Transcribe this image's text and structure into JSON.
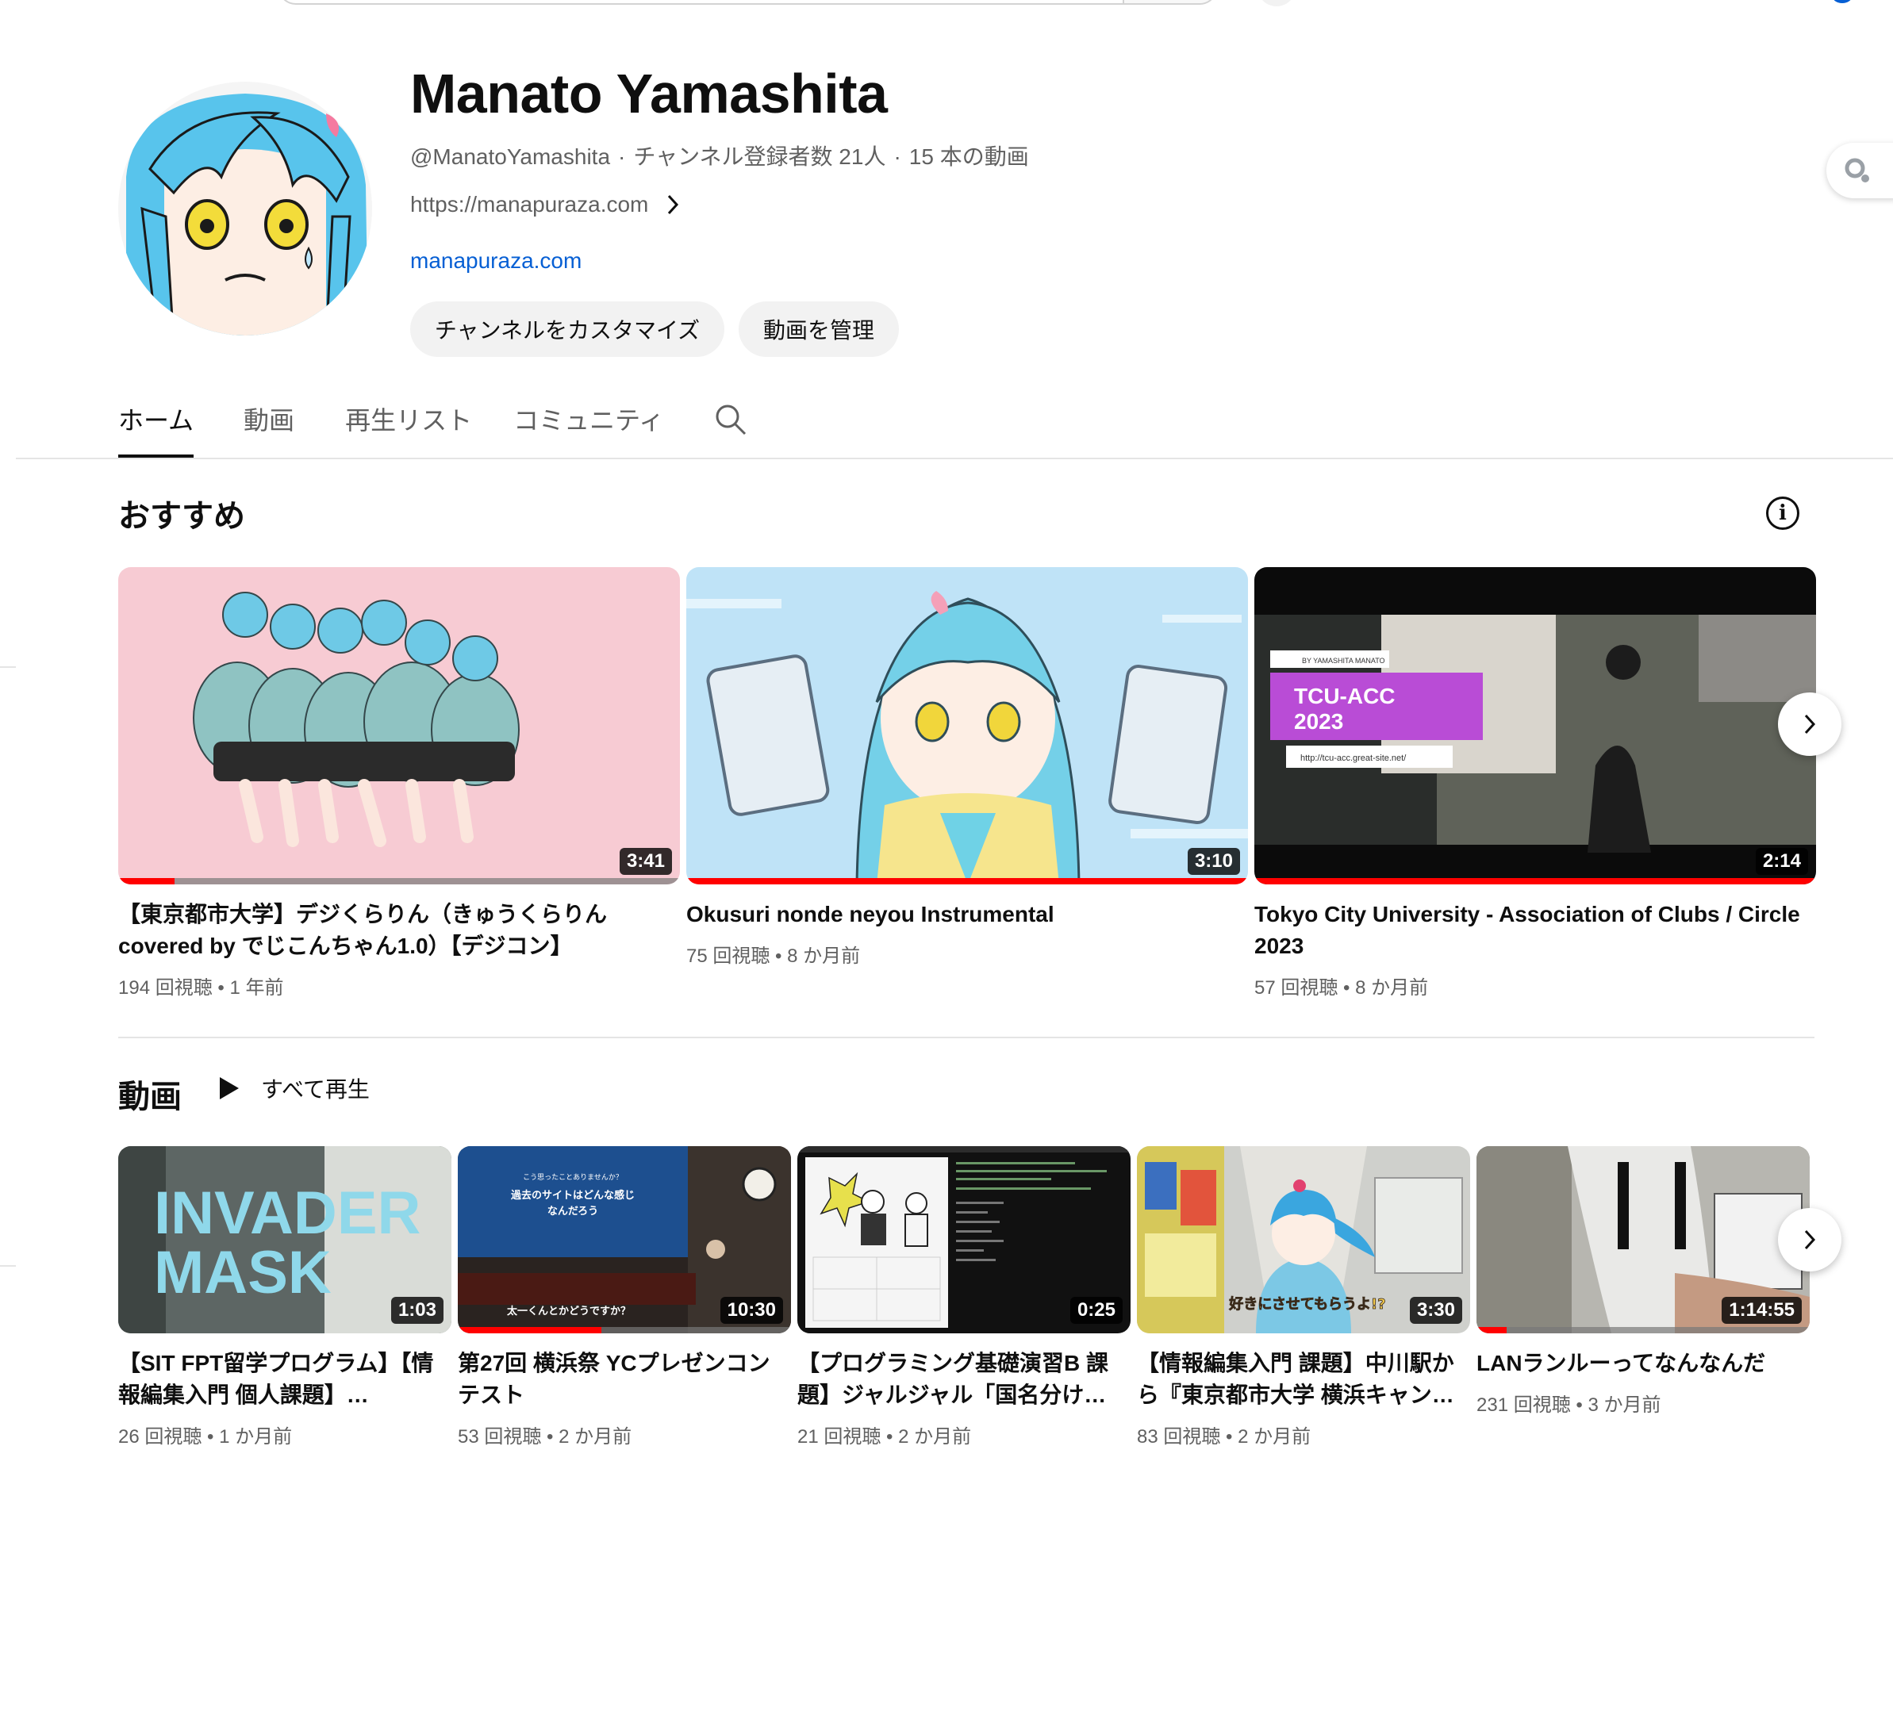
{
  "channel": {
    "name": "Manato Yamashita",
    "handle": "@ManatoYamashita",
    "subscribers": "チャンネル登録者数 21人",
    "video_count": "15 本の動画",
    "meta_separator": "·",
    "description_link": "https://manapuraza.com",
    "link": "manapuraza.com",
    "customize_label": "チャンネルをカスタマイズ",
    "manage_label": "動画を管理"
  },
  "tabs": [
    {
      "label": "ホーム",
      "active": true
    },
    {
      "label": "動画",
      "active": false
    },
    {
      "label": "再生リスト",
      "active": false
    },
    {
      "label": "コミュニティ",
      "active": false
    }
  ],
  "featured": {
    "title": "おすすめ",
    "info_label": "i",
    "videos": [
      {
        "title": "【東京都市大学】デジくらりん（きゅうくらりん covered by でじこんちゃん1.0）【デジコン】",
        "duration": "3:41",
        "views": "194 回視聴",
        "age": "1 年前",
        "watched_fraction": 0.1
      },
      {
        "title": "Okusuri nonde neyou Instrumental",
        "duration": "3:10",
        "views": "75 回視聴",
        "age": "8 か月前",
        "watched_fraction": 1.0
      },
      {
        "title": "Tokyo City University - Association of Clubs / Circle 2023",
        "duration": "2:14",
        "views": "57 回視聴",
        "age": "8 か月前",
        "watched_fraction": 1.0
      }
    ],
    "thumb_texts": {
      "tcu_by": "BY YAMASHITA MANATO",
      "tcu_title_1": "TCU-ACC",
      "tcu_title_2": "2023",
      "tcu_url": "http://tcu-acc.great-site.net/"
    }
  },
  "videos_section": {
    "title": "動画",
    "play_all_label": "すべて再生",
    "videos": [
      {
        "title": "【SIT FPT留学プログラム】【情報編集入門 個人課題】INVADER MASK",
        "duration": "1:03",
        "views": "26 回視聴",
        "age": "1 か月前",
        "watched_fraction": 0
      },
      {
        "title": "第27回 横浜祭 YCプレゼンコンテスト",
        "duration": "10:30",
        "views": "53 回視聴",
        "age": "2 か月前",
        "watched_fraction": 0.43
      },
      {
        "title": "【プログラミング基礎演習B 課題】ジャルジャル「国名分けっこ」",
        "duration": "0:25",
        "views": "21 回視聴",
        "age": "2 か月前",
        "watched_fraction": 0
      },
      {
        "title": "【情報編集入門 課題】中川駅から『東京都市大学 横浜キャンパス』",
        "duration": "3:30",
        "views": "83 回視聴",
        "age": "2 か月前",
        "watched_fraction": 0
      },
      {
        "title": "LANランルーってなんなんだ",
        "duration": "1:14:55",
        "views": "231 回視聴",
        "age": "3 か月前",
        "watched_fraction": 0.09
      }
    ],
    "thumb_texts": {
      "invader_1": "INVADER",
      "invader_2": "MASK",
      "yc_q": "こう思ったことありませんか？",
      "yc_line1": "過去のサイトはどんな感じ",
      "yc_line2": "なんだろう",
      "yc_caption": "太一くんとかどうですか？",
      "campus_caption": "好きにさせてもらうよ!?"
    }
  },
  "colors": {
    "progress_red": "#ff0000",
    "link_blue": "#065fd4",
    "meta_gray": "#606060"
  },
  "icons": [
    "search-icon",
    "chevron-right-icon",
    "info-icon",
    "play-icon",
    "lens-icon"
  ]
}
